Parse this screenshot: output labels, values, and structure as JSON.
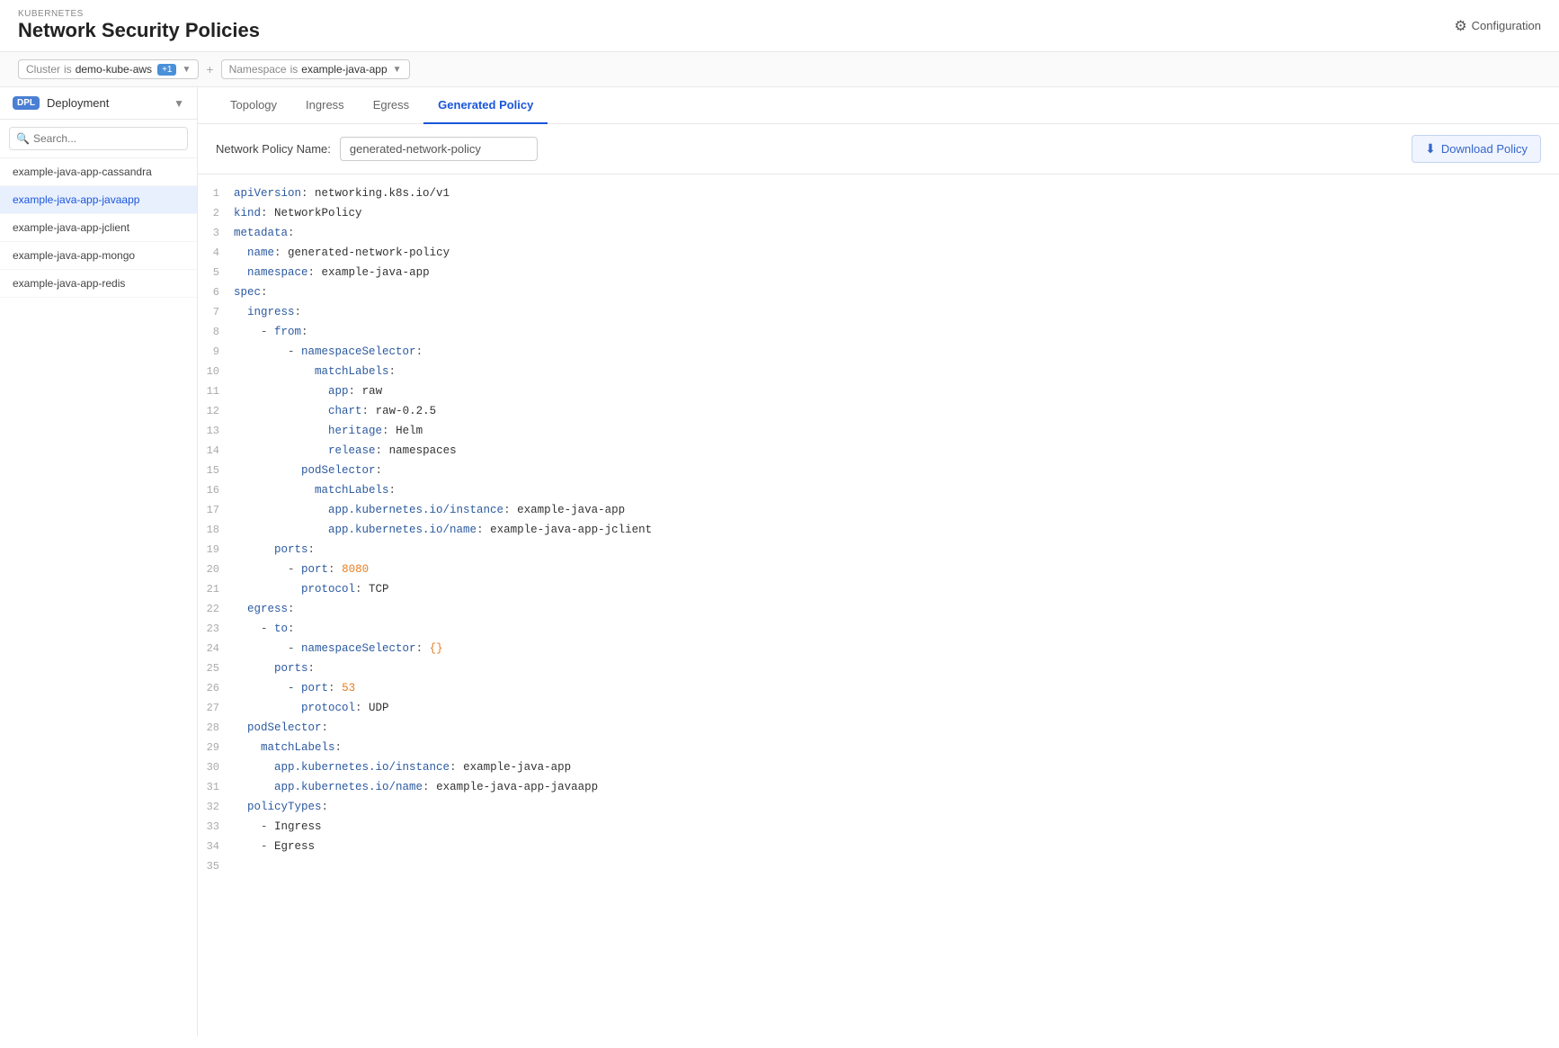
{
  "header": {
    "kubernetes_label": "KUBERNETES",
    "page_title": "Network Security Policies",
    "config_label": "Configuration"
  },
  "filter_bar": {
    "cluster_label": "Cluster",
    "cluster_is": "is",
    "cluster_value": "demo-kube-aws",
    "cluster_badge": "+1",
    "namespace_label": "Namespace",
    "namespace_is": "is",
    "namespace_value": "example-java-app",
    "plus_sign": "+"
  },
  "sidebar": {
    "header_badge": "DPL",
    "header_label": "Deployment",
    "search_placeholder": "Search...",
    "items": [
      {
        "id": "cassandra",
        "label": "example-java-app-cassandra",
        "active": false
      },
      {
        "id": "javaapp",
        "label": "example-java-app-javaapp",
        "active": true
      },
      {
        "id": "jclient",
        "label": "example-java-app-jclient",
        "active": false
      },
      {
        "id": "mongo",
        "label": "example-java-app-mongo",
        "active": false
      },
      {
        "id": "redis",
        "label": "example-java-app-redis",
        "active": false
      }
    ]
  },
  "tabs": [
    {
      "id": "topology",
      "label": "Topology",
      "active": false
    },
    {
      "id": "ingress",
      "label": "Ingress",
      "active": false
    },
    {
      "id": "egress",
      "label": "Egress",
      "active": false
    },
    {
      "id": "generated-policy",
      "label": "Generated Policy",
      "active": true
    }
  ],
  "policy_section": {
    "name_label": "Network Policy Name:",
    "name_value": "generated-network-policy",
    "download_label": "Download Policy"
  },
  "code_lines": [
    {
      "num": 1,
      "content": [
        {
          "type": "key",
          "text": "apiVersion"
        },
        {
          "type": "colon",
          "text": ": "
        },
        {
          "type": "plain",
          "text": "networking.k8s.io/v1"
        }
      ]
    },
    {
      "num": 2,
      "content": [
        {
          "type": "key",
          "text": "kind"
        },
        {
          "type": "colon",
          "text": ": "
        },
        {
          "type": "plain",
          "text": "NetworkPolicy"
        }
      ]
    },
    {
      "num": 3,
      "content": [
        {
          "type": "key",
          "text": "metadata"
        },
        {
          "type": "colon",
          "text": ":"
        }
      ]
    },
    {
      "num": 4,
      "content": [
        {
          "type": "plain",
          "text": "  "
        },
        {
          "type": "key",
          "text": "name"
        },
        {
          "type": "colon",
          "text": ": "
        },
        {
          "type": "plain",
          "text": "generated-network-policy"
        }
      ]
    },
    {
      "num": 5,
      "content": [
        {
          "type": "plain",
          "text": "  "
        },
        {
          "type": "key",
          "text": "namespace"
        },
        {
          "type": "colon",
          "text": ": "
        },
        {
          "type": "plain",
          "text": "example-java-app"
        }
      ]
    },
    {
      "num": 6,
      "content": [
        {
          "type": "key",
          "text": "spec"
        },
        {
          "type": "colon",
          "text": ":"
        }
      ]
    },
    {
      "num": 7,
      "content": [
        {
          "type": "plain",
          "text": "  "
        },
        {
          "type": "key",
          "text": "ingress"
        },
        {
          "type": "colon",
          "text": ":"
        }
      ]
    },
    {
      "num": 8,
      "content": [
        {
          "type": "plain",
          "text": "    "
        },
        {
          "type": "dash",
          "text": "- "
        },
        {
          "type": "key",
          "text": "from"
        },
        {
          "type": "colon",
          "text": ":"
        }
      ]
    },
    {
      "num": 9,
      "content": [
        {
          "type": "plain",
          "text": "        "
        },
        {
          "type": "dash",
          "text": "- "
        },
        {
          "type": "key",
          "text": "namespaceSelector"
        },
        {
          "type": "colon",
          "text": ":"
        }
      ]
    },
    {
      "num": 10,
      "content": [
        {
          "type": "plain",
          "text": "            "
        },
        {
          "type": "key",
          "text": "matchLabels"
        },
        {
          "type": "colon",
          "text": ":"
        }
      ]
    },
    {
      "num": 11,
      "content": [
        {
          "type": "plain",
          "text": "              "
        },
        {
          "type": "key",
          "text": "app"
        },
        {
          "type": "colon",
          "text": ": "
        },
        {
          "type": "plain",
          "text": "raw"
        }
      ]
    },
    {
      "num": 12,
      "content": [
        {
          "type": "plain",
          "text": "              "
        },
        {
          "type": "key",
          "text": "chart"
        },
        {
          "type": "colon",
          "text": ": "
        },
        {
          "type": "plain",
          "text": "raw-0.2.5"
        }
      ]
    },
    {
      "num": 13,
      "content": [
        {
          "type": "plain",
          "text": "              "
        },
        {
          "type": "key",
          "text": "heritage"
        },
        {
          "type": "colon",
          "text": ": "
        },
        {
          "type": "plain",
          "text": "Helm"
        }
      ]
    },
    {
      "num": 14,
      "content": [
        {
          "type": "plain",
          "text": "              "
        },
        {
          "type": "key",
          "text": "release"
        },
        {
          "type": "colon",
          "text": ": "
        },
        {
          "type": "plain",
          "text": "namespaces"
        }
      ]
    },
    {
      "num": 15,
      "content": [
        {
          "type": "plain",
          "text": "          "
        },
        {
          "type": "key",
          "text": "podSelector"
        },
        {
          "type": "colon",
          "text": ":"
        }
      ]
    },
    {
      "num": 16,
      "content": [
        {
          "type": "plain",
          "text": "            "
        },
        {
          "type": "key",
          "text": "matchLabels"
        },
        {
          "type": "colon",
          "text": ":"
        }
      ]
    },
    {
      "num": 17,
      "content": [
        {
          "type": "plain",
          "text": "              "
        },
        {
          "type": "key",
          "text": "app.kubernetes.io/instance"
        },
        {
          "type": "colon",
          "text": ": "
        },
        {
          "type": "plain",
          "text": "example-java-app"
        }
      ]
    },
    {
      "num": 18,
      "content": [
        {
          "type": "plain",
          "text": "              "
        },
        {
          "type": "key",
          "text": "app.kubernetes.io/name"
        },
        {
          "type": "colon",
          "text": ": "
        },
        {
          "type": "plain",
          "text": "example-java-app-jclient"
        }
      ]
    },
    {
      "num": 19,
      "content": [
        {
          "type": "plain",
          "text": "      "
        },
        {
          "type": "key",
          "text": "ports"
        },
        {
          "type": "colon",
          "text": ":"
        }
      ]
    },
    {
      "num": 20,
      "content": [
        {
          "type": "plain",
          "text": "        "
        },
        {
          "type": "dash",
          "text": "- "
        },
        {
          "type": "key",
          "text": "port"
        },
        {
          "type": "colon",
          "text": ": "
        },
        {
          "type": "val-number",
          "text": "8080"
        }
      ]
    },
    {
      "num": 21,
      "content": [
        {
          "type": "plain",
          "text": "          "
        },
        {
          "type": "key",
          "text": "protocol"
        },
        {
          "type": "colon",
          "text": ": "
        },
        {
          "type": "plain",
          "text": "TCP"
        }
      ]
    },
    {
      "num": 22,
      "content": [
        {
          "type": "plain",
          "text": "  "
        },
        {
          "type": "key",
          "text": "egress"
        },
        {
          "type": "colon",
          "text": ":"
        }
      ]
    },
    {
      "num": 23,
      "content": [
        {
          "type": "plain",
          "text": "    "
        },
        {
          "type": "dash",
          "text": "- "
        },
        {
          "type": "key",
          "text": "to"
        },
        {
          "type": "colon",
          "text": ":"
        }
      ]
    },
    {
      "num": 24,
      "content": [
        {
          "type": "plain",
          "text": "        "
        },
        {
          "type": "dash",
          "text": "- "
        },
        {
          "type": "key",
          "text": "namespaceSelector"
        },
        {
          "type": "colon",
          "text": ": "
        },
        {
          "type": "brace",
          "text": "{}"
        }
      ]
    },
    {
      "num": 25,
      "content": [
        {
          "type": "plain",
          "text": "      "
        },
        {
          "type": "key",
          "text": "ports"
        },
        {
          "type": "colon",
          "text": ":"
        }
      ]
    },
    {
      "num": 26,
      "content": [
        {
          "type": "plain",
          "text": "        "
        },
        {
          "type": "dash",
          "text": "- "
        },
        {
          "type": "key",
          "text": "port"
        },
        {
          "type": "colon",
          "text": ": "
        },
        {
          "type": "val-number",
          "text": "53"
        }
      ]
    },
    {
      "num": 27,
      "content": [
        {
          "type": "plain",
          "text": "          "
        },
        {
          "type": "key",
          "text": "protocol"
        },
        {
          "type": "colon",
          "text": ": "
        },
        {
          "type": "plain",
          "text": "UDP"
        }
      ]
    },
    {
      "num": 28,
      "content": [
        {
          "type": "plain",
          "text": "  "
        },
        {
          "type": "key",
          "text": "podSelector"
        },
        {
          "type": "colon",
          "text": ":"
        }
      ]
    },
    {
      "num": 29,
      "content": [
        {
          "type": "plain",
          "text": "    "
        },
        {
          "type": "key",
          "text": "matchLabels"
        },
        {
          "type": "colon",
          "text": ":"
        }
      ]
    },
    {
      "num": 30,
      "content": [
        {
          "type": "plain",
          "text": "      "
        },
        {
          "type": "key",
          "text": "app.kubernetes.io/instance"
        },
        {
          "type": "colon",
          "text": ": "
        },
        {
          "type": "plain",
          "text": "example-java-app"
        }
      ]
    },
    {
      "num": 31,
      "content": [
        {
          "type": "plain",
          "text": "      "
        },
        {
          "type": "key",
          "text": "app.kubernetes.io/name"
        },
        {
          "type": "colon",
          "text": ": "
        },
        {
          "type": "plain",
          "text": "example-java-app-javaapp"
        }
      ]
    },
    {
      "num": 32,
      "content": [
        {
          "type": "plain",
          "text": "  "
        },
        {
          "type": "key",
          "text": "policyTypes"
        },
        {
          "type": "colon",
          "text": ":"
        }
      ]
    },
    {
      "num": 33,
      "content": [
        {
          "type": "plain",
          "text": "    "
        },
        {
          "type": "dash",
          "text": "- "
        },
        {
          "type": "plain",
          "text": "Ingress"
        }
      ]
    },
    {
      "num": 34,
      "content": [
        {
          "type": "plain",
          "text": "    "
        },
        {
          "type": "dash",
          "text": "- "
        },
        {
          "type": "plain",
          "text": "Egress"
        }
      ]
    },
    {
      "num": 35,
      "content": []
    }
  ]
}
